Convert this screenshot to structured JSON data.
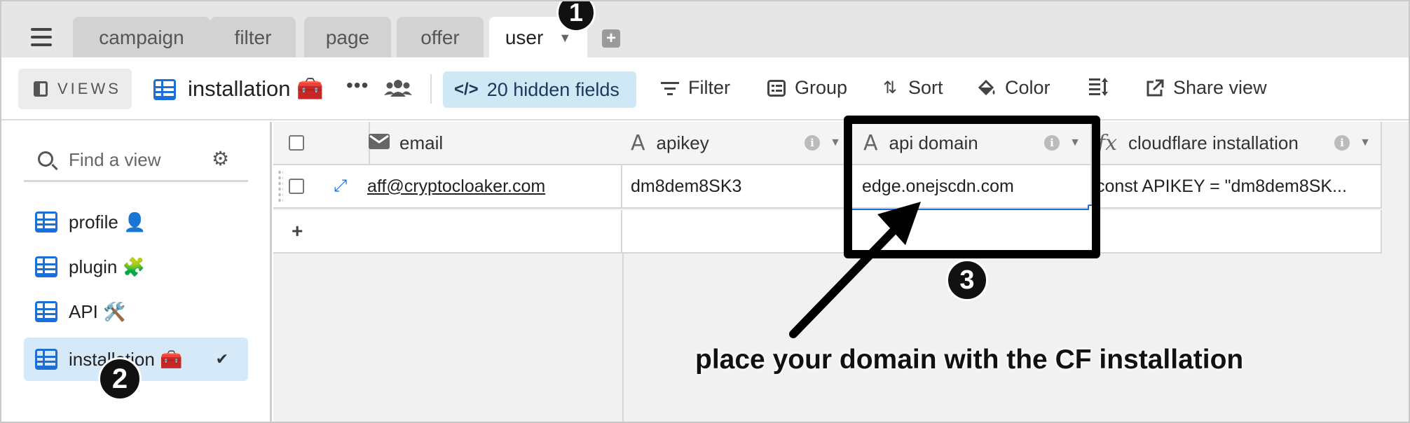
{
  "tabs": [
    {
      "label": "campaign"
    },
    {
      "label": "filter"
    },
    {
      "label": "page"
    },
    {
      "label": "offer"
    },
    {
      "label": "user",
      "active": true
    }
  ],
  "toolbar": {
    "views_label": "VIEWS",
    "view_name": "installation 🧰",
    "more_label": "•••",
    "hidden_fields_label": "20 hidden fields",
    "filter_label": "Filter",
    "group_label": "Group",
    "sort_label": "Sort",
    "color_label": "Color",
    "share_label": "Share view"
  },
  "sidebar": {
    "search_placeholder": "Find a view",
    "items": [
      {
        "label": "profile 👤"
      },
      {
        "label": "plugin 🧩"
      },
      {
        "label": "API 🛠️"
      },
      {
        "label": "installation 🧰",
        "selected": true
      }
    ]
  },
  "grid": {
    "columns": [
      {
        "name": "email",
        "type_icon": "email-icon"
      },
      {
        "name": "apikey",
        "type_icon": "text-field-icon"
      },
      {
        "name": "api domain",
        "type_icon": "text-field-icon"
      },
      {
        "name": "cloudflare installation",
        "type_icon": "formula-icon"
      }
    ],
    "rows": [
      {
        "email": "aff@cryptocloaker.com",
        "apikey": "dm8dem8SK3",
        "api_domain": "edge.onejscdn.com",
        "cloudflare_installation": "const APIKEY = \"dm8dem8SK..."
      }
    ],
    "add_row": "+"
  },
  "annotations": {
    "badge_1": "1",
    "badge_2": "2",
    "badge_3": "3",
    "caption": "place your domain with the CF installation"
  },
  "colors": {
    "accent_blue": "#1b6fd6",
    "hidden_fields_bg": "#cfe8f6",
    "selected_view_bg": "#d5e9f8"
  }
}
